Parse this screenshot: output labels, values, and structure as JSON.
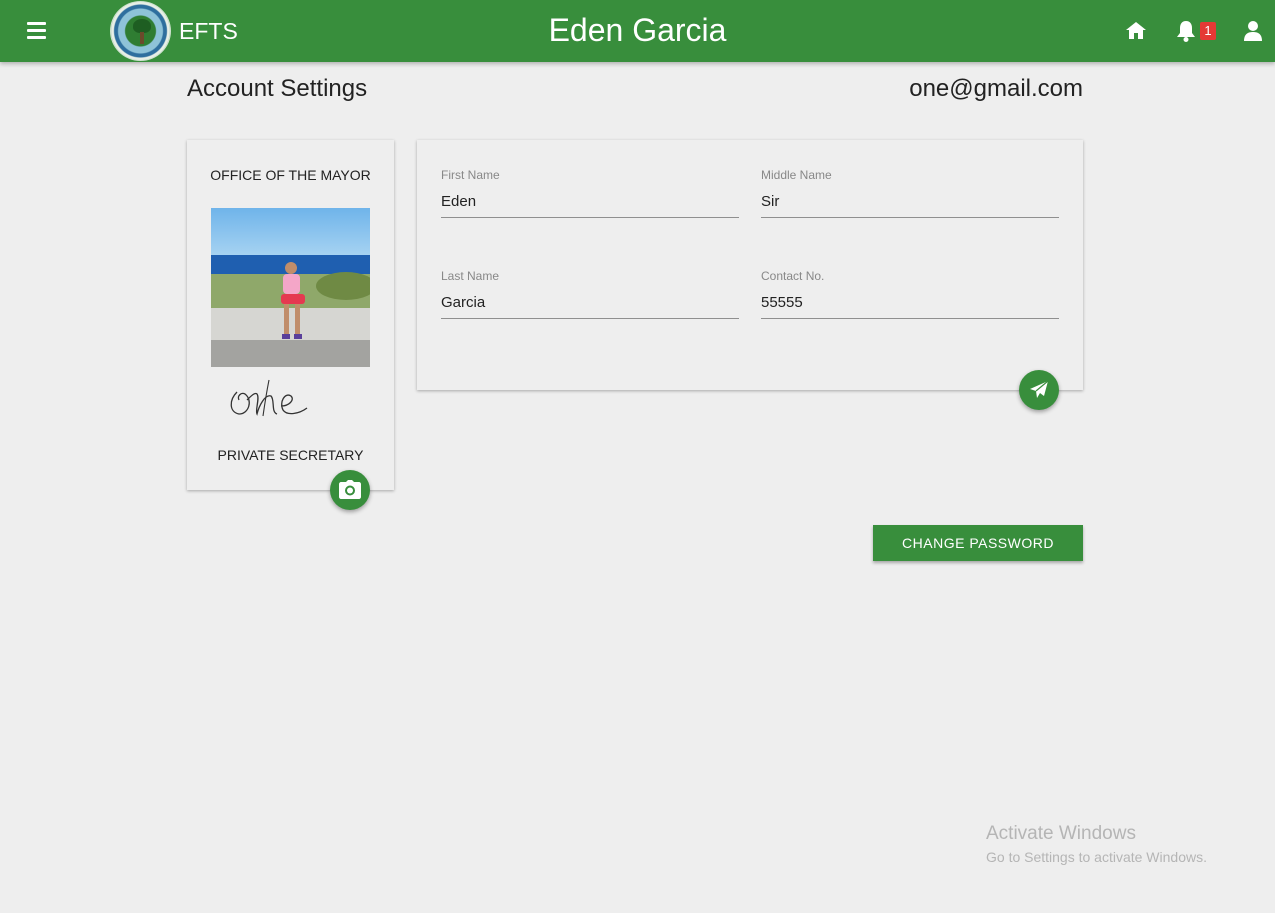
{
  "header": {
    "brand": "EFTS",
    "title": "Eden Garcia",
    "notification_count": "1"
  },
  "page": {
    "title": "Account Settings",
    "email": "one@gmail.com"
  },
  "profile": {
    "office": "OFFICE OF THE MAYOR",
    "position": "PRIVATE SECRETARY",
    "signature_text": "one"
  },
  "form": {
    "first_name_label": "First Name",
    "first_name_value": "Eden",
    "middle_name_label": "Middle Name",
    "middle_name_value": "Sir",
    "last_name_label": "Last Name",
    "last_name_value": "Garcia",
    "contact_label": "Contact No.",
    "contact_value": "55555"
  },
  "actions": {
    "change_password": "CHANGE PASSWORD"
  },
  "watermark": {
    "title": "Activate Windows",
    "subtitle": "Go to Settings to activate Windows."
  },
  "colors": {
    "primary": "#388e3c",
    "badge": "#e53935",
    "background": "#eeeeee"
  },
  "icons": [
    "menu-icon",
    "logo",
    "home-icon",
    "bell-icon",
    "user-icon",
    "camera-icon",
    "send-icon"
  ]
}
